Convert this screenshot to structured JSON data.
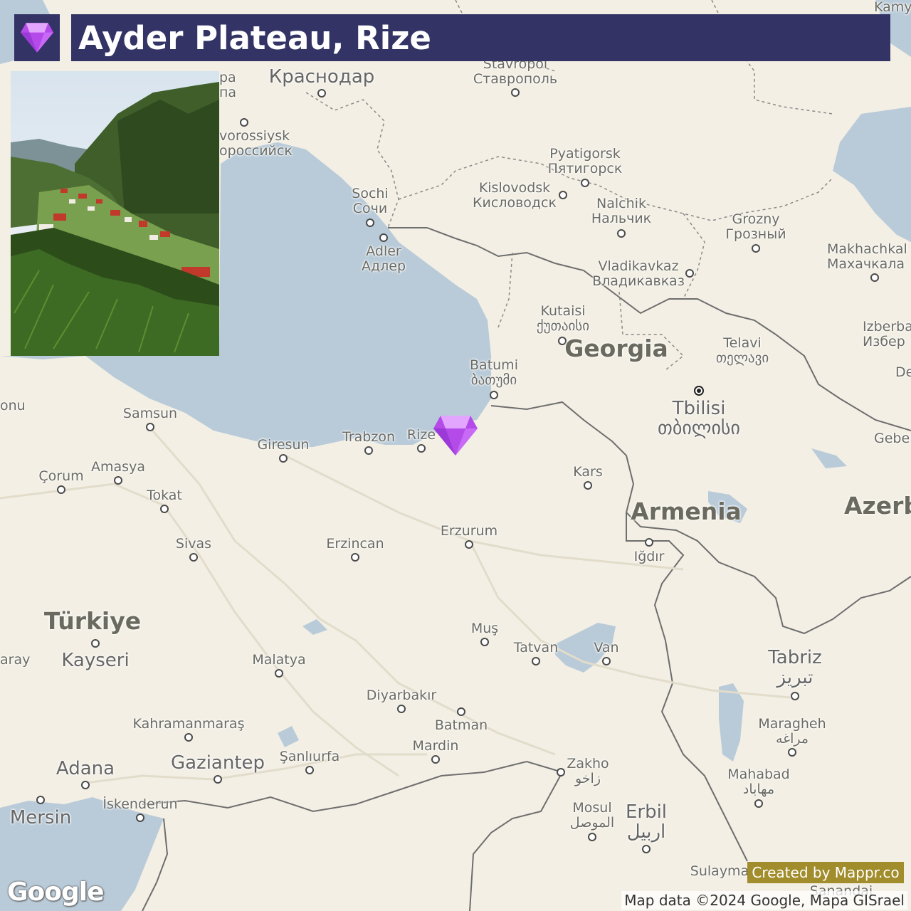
{
  "title": "Ayder Plateau, Rize",
  "marker_icon": "gem-icon",
  "colors": {
    "title_bar": "#333366",
    "water": "#b9cbd9",
    "land": "#f3efe4",
    "badge": "#a28d2c",
    "gem": "#c263f5"
  },
  "labels": {
    "krasnodar": "Краснодар",
    "stavropol_en": "Stavropol",
    "stavropol_ru": "Ставрополь",
    "pyatigorsk_en": "Pyatigorsk",
    "pyatigorsk_ru": "Пятигорск",
    "kislovodsk_en": "Kislovodsk",
    "kislovodsk_ru": "Кисловодск",
    "nalchik_en": "Nalchik",
    "nalchik_ru": "Нальчик",
    "grozny_en": "Grozny",
    "grozny_ru": "Грозный",
    "makhachkala_en": "Makhachkal",
    "makhachkala_ru": "Махачкала",
    "vladikavkaz_en": "Vladikavkaz",
    "vladikavkaz_ru": "Владикавказ",
    "novorossiysk_en": "vorossiysk",
    "novorossiysk_ru": "ороссийск",
    "anapa_en": "pa",
    "anapa_ru": "па",
    "sochi_en": "Sochi",
    "sochi_ru": "Сочи",
    "adler_en": "Adler",
    "adler_ru": "Адлер",
    "kutaisi_en": "Kutaisi",
    "kutaisi_ka": "ქუთაისი",
    "georgia": "Georgia",
    "telavi_en": "Telavi",
    "telavi_ka": "თელავი",
    "izberbash_en": "Izberba",
    "izberbash_ru": "Избер",
    "batumi_en": "Batumi",
    "batumi_ka": "ბათუმი",
    "tbilisi_en": "Tbilisi",
    "tbilisi_ka": "თბილისი",
    "samsun": "Samsun",
    "giresun": "Giresun",
    "trabzon": "Trabzon",
    "rize": "Rize",
    "kars": "Kars",
    "armenia": "Armenia",
    "azerbaijan": "Azerb",
    "corum": "Çorum",
    "amasya": "Amasya",
    "tokat": "Tokat",
    "erzurum": "Erzurum",
    "erzincan": "Erzincan",
    "sivas": "Sivas",
    "igdir": "Iğdır",
    "turkiye": "Türkiye",
    "kayseri": "Kayseri",
    "mus": "Muş",
    "tatvan": "Tatvan",
    "van": "Van",
    "tabriz_en": "Tabriz",
    "tabriz_fa": "تبریز",
    "malatya": "Malatya",
    "diyarbakir": "Diyarbakır",
    "batman": "Batman",
    "kahramanmaras": "Kahramanmaraş",
    "maragheh_en": "Maragheh",
    "maragheh_fa": "مراغه",
    "mardin": "Mardin",
    "adana": "Adana",
    "gaziantep": "Gaziantep",
    "sanliurfa": "Şanlıurfa",
    "zakho_en": "Zakho",
    "zakho_ar": "زاخو",
    "mahabad_en": "Mahabad",
    "mahabad_fa": "مهاباد",
    "iskenderun": "İskenderun",
    "mersin": "Mersin",
    "mosul_en": "Mosul",
    "mosul_ar": "الموصل",
    "erbil_en": "Erbil",
    "erbil_ar": "اربيل",
    "sulaymaniyah": "Sulayma",
    "sanandaj": "Sanandaj",
    "aksaray": "aray",
    "onu": "onu",
    "gebele": "Gebel",
    "derbent": "De",
    "kamyshin": "Kamy"
  },
  "mappr_credit": "Created by Mappr.co",
  "attribution": "Map data ©2024 Google, Mapa GISrael",
  "google_logo": "Google"
}
